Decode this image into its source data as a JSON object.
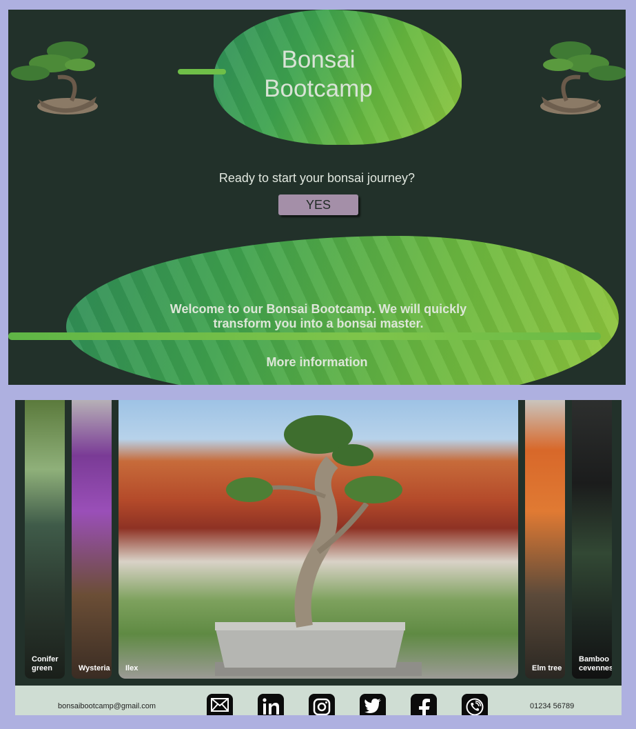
{
  "hero": {
    "title_line1": "Bonsai",
    "title_line2": "Bootcamp",
    "prompt": "Ready to start your bonsai journey?",
    "yes_label": "YES",
    "welcome": "Welcome to our Bonsai Bootcamp. We will quickly transform you into a bonsai master.",
    "more_info": "More information"
  },
  "gallery": {
    "panels": [
      {
        "label": "Conifer green"
      },
      {
        "label": "Wysteria"
      },
      {
        "label": "Ilex"
      },
      {
        "label": "Elm tree"
      },
      {
        "label": "Bamboo cevennes"
      }
    ]
  },
  "footer": {
    "email": "bonsaibootcamp@gmail.com",
    "phone": "01234 56789",
    "social_icons": [
      "mail-icon",
      "linkedin-icon",
      "instagram-icon",
      "twitter-icon",
      "facebook-icon",
      "phone-icon"
    ]
  },
  "colors": {
    "page_background": "#aeb0e0",
    "hero_background": "#22312a",
    "leaf_green": "#66b83f",
    "yes_button": "#a48fa8",
    "footer_background": "#cfddd3"
  }
}
